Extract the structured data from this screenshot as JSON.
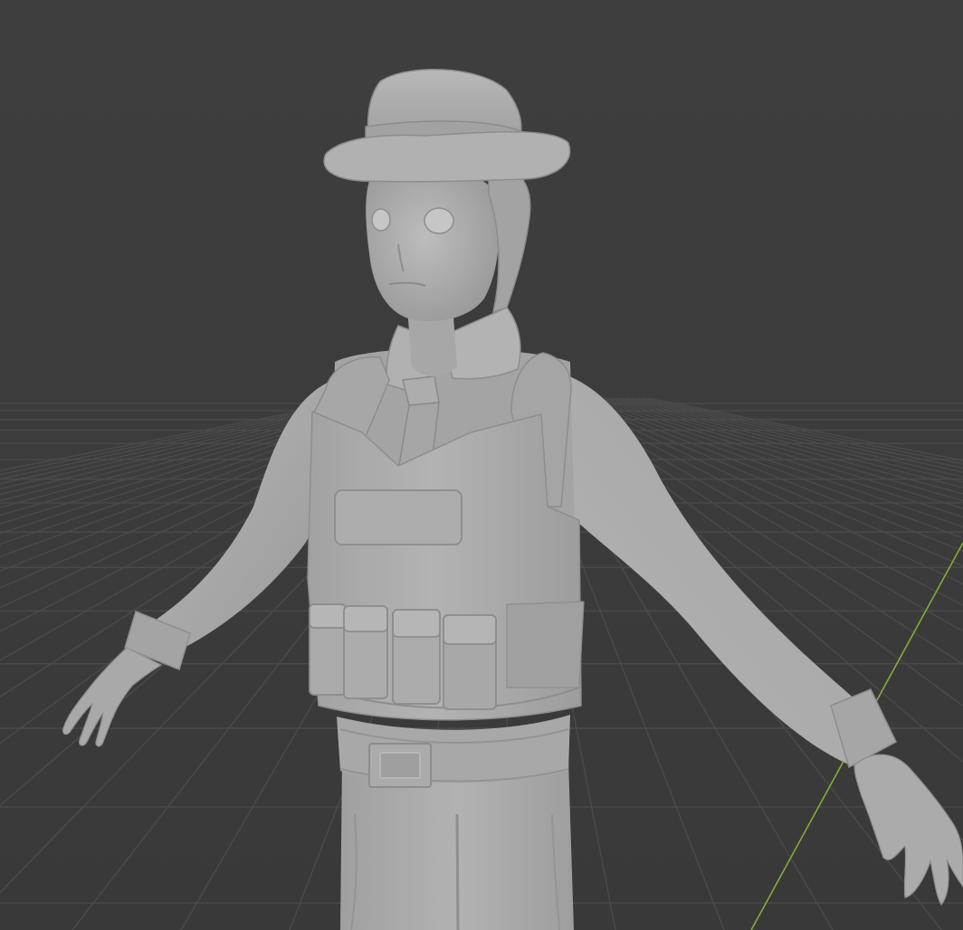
{
  "viewport": {
    "mode": "solid-shading",
    "background_color": "#3d3d3d",
    "grid_color": "#4a4a4a",
    "y_axis_color": "#7fae3a",
    "model_base_color": "#a9a9a9",
    "model_shadow_color": "#8a8a8a",
    "model_highlight_color": "#c2c2c2"
  },
  "model": {
    "pose": "t-pose",
    "parts": [
      "hat-icon",
      "head-icon",
      "hair-icon",
      "collar-icon",
      "necktie-icon",
      "tactical-vest-icon",
      "chest-patch-icon",
      "magazine-pouch-icon",
      "left-arm-icon",
      "right-arm-icon",
      "left-hand-icon",
      "right-hand-icon",
      "belt-icon",
      "belt-buckle-icon",
      "trousers-icon"
    ]
  }
}
